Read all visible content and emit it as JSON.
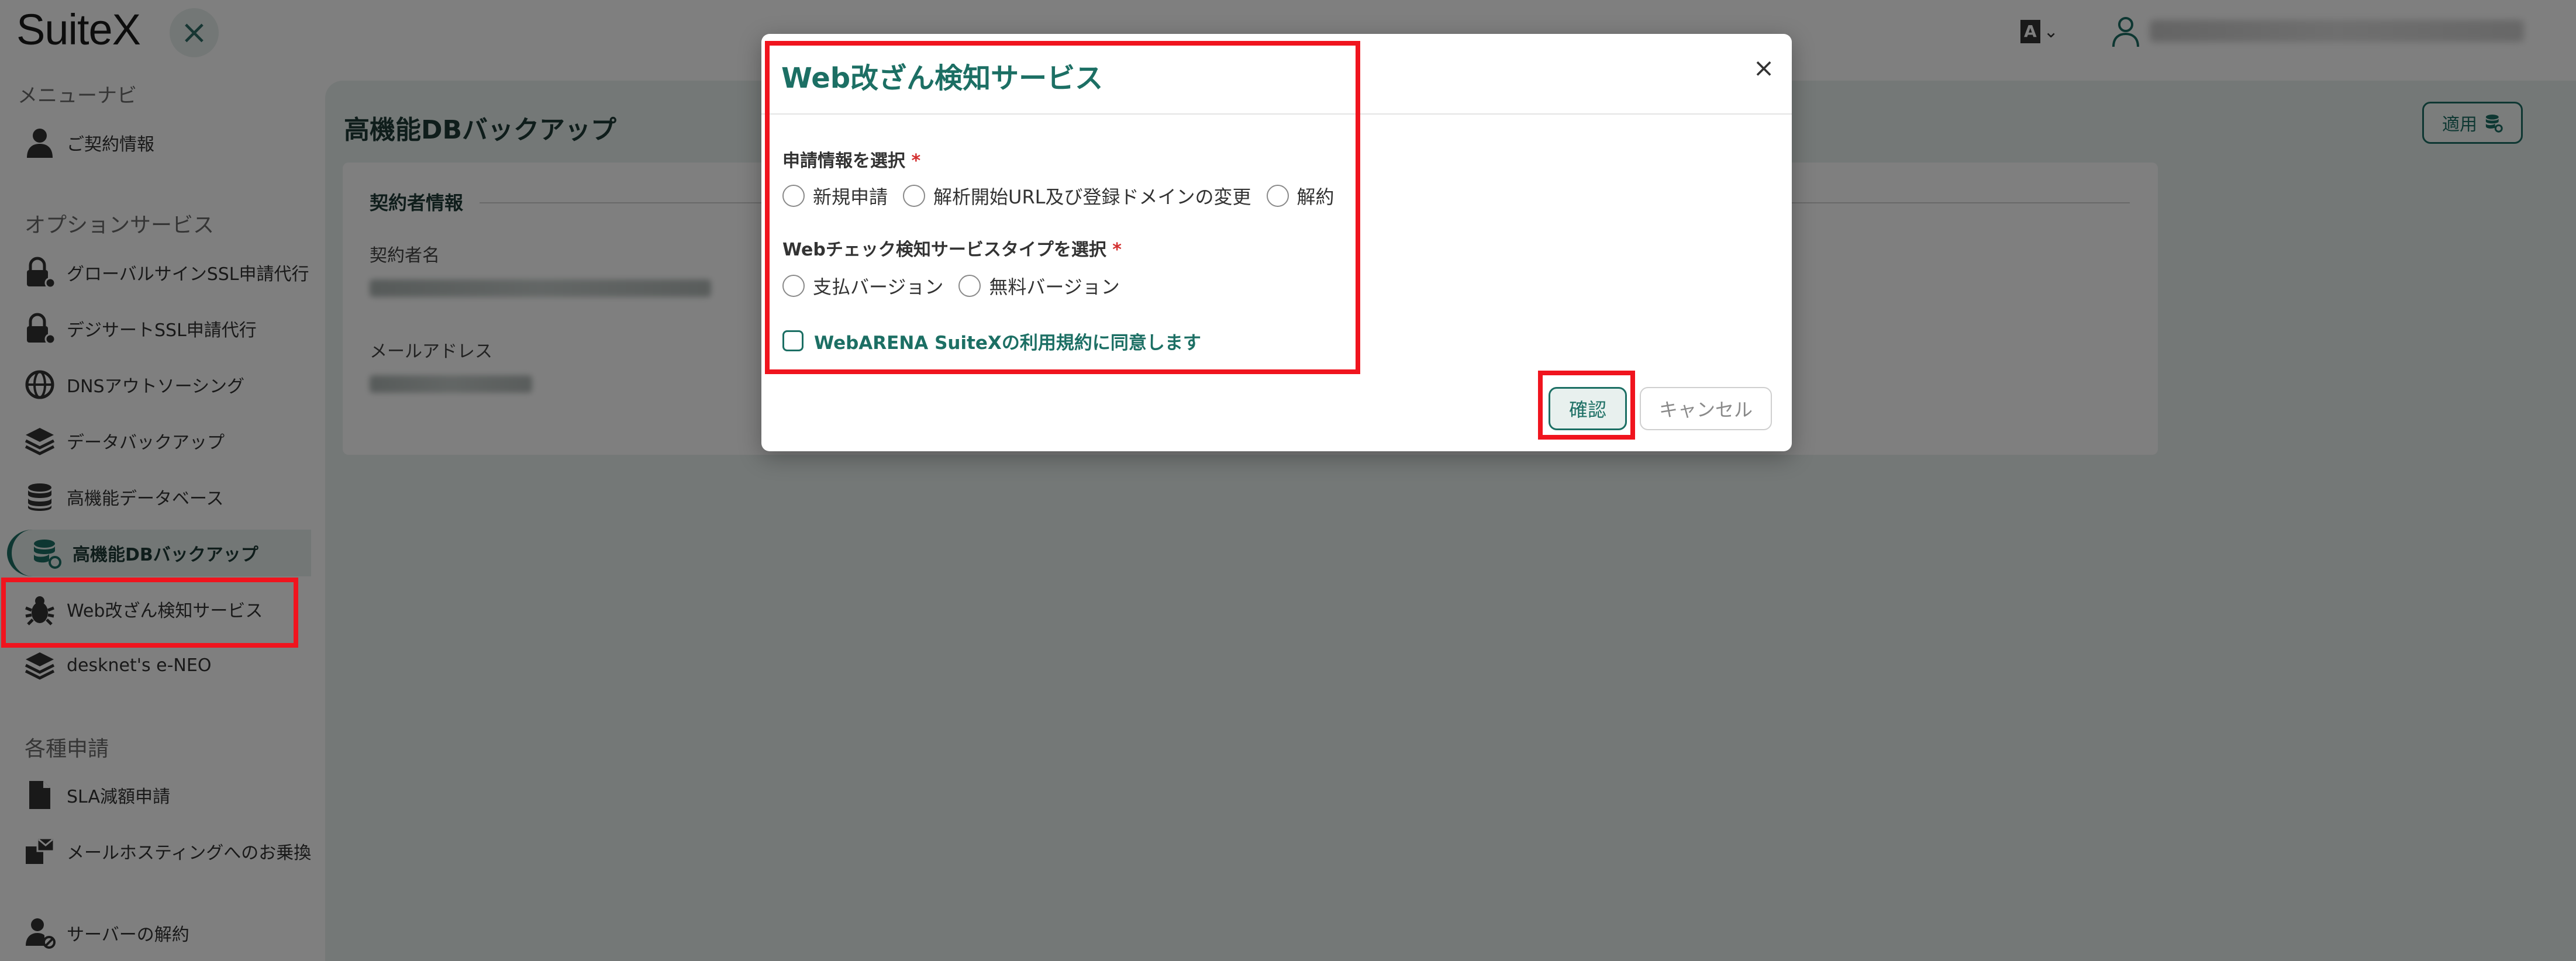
{
  "app": {
    "logo": "SuiteX",
    "close_symbol": "×",
    "lang_glyph": "A",
    "lang_chevron": "⌄"
  },
  "sidebar": {
    "menu_nav_label": "メニューナビ",
    "contract_info": "ご契約情報",
    "option_services_label": "オプションサービス",
    "items": [
      {
        "label": "グローバルサインSSL申請代行",
        "icon": "lock-gear-icon"
      },
      {
        "label": "デジサートSSL申請代行",
        "icon": "lock-gear-icon"
      },
      {
        "label": "DNSアウトソーシング",
        "icon": "globe-icon"
      },
      {
        "label": "データバックアップ",
        "icon": "layers-icon"
      },
      {
        "label": "高機能データベース",
        "icon": "database-icon"
      },
      {
        "label": "高機能DBバックアップ",
        "icon": "database-refresh-icon",
        "active": true
      },
      {
        "label": "Web改ざん検知サービス",
        "icon": "bug-icon",
        "highlighted": true
      },
      {
        "label": "desknet's e-NEO",
        "icon": "layers-icon"
      }
    ],
    "applications_label": "各種申請",
    "applications": [
      {
        "label": "SLA減額申請",
        "icon": "document-icon"
      },
      {
        "label": "メールホスティングへのお乗換",
        "icon": "mail-transfer-icon"
      },
      {
        "label": "サーバーの解約",
        "icon": "user-cancel-icon"
      }
    ]
  },
  "main": {
    "page_title": "高機能DBバックアップ",
    "apply_button": "適用",
    "card_title": "契約者情報",
    "contract_name_label": "契約者名",
    "email_label": "メールアドレス"
  },
  "modal": {
    "title": "Web改ざん検知サービス",
    "close": "×",
    "request_label": "申請情報を選択",
    "required_mark": "*",
    "request_options": [
      "新規申請",
      "解析開始URL及び登録ドメインの変更",
      "解約"
    ],
    "service_type_label": "Webチェック検知サービスタイプを選択",
    "service_type_options": [
      "支払バージョン",
      "無料バージョン"
    ],
    "terms_checkbox": "WebARENA SuiteXの利用規約に同意します",
    "confirm_button": "確認",
    "cancel_button": "キャンセル"
  },
  "colors": {
    "accent": "#1c6f64",
    "highlight": "#f0141e",
    "required": "#d32f2f"
  }
}
